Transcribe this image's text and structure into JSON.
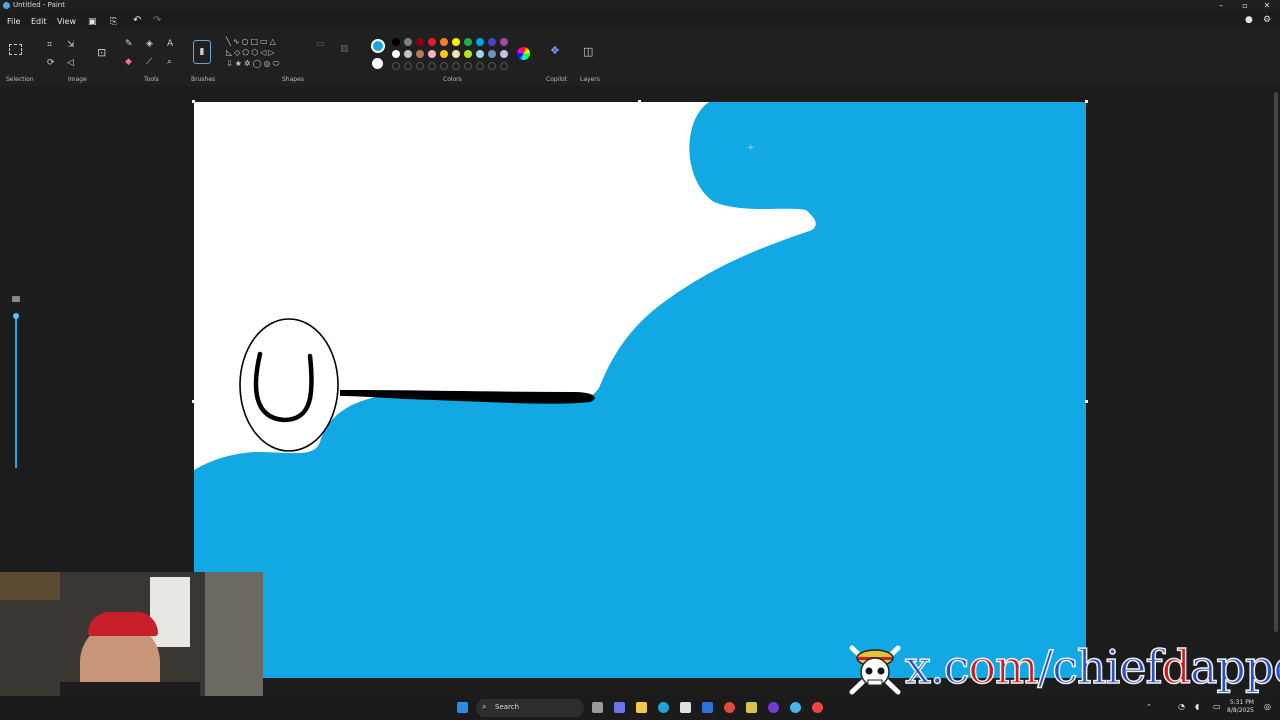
{
  "window": {
    "title": "Untitled - Paint",
    "controls": {
      "minimize": "–",
      "maximize": "▫",
      "close": "✕"
    }
  },
  "menu": {
    "file": "File",
    "edit": "Edit",
    "view": "View"
  },
  "ribbon": {
    "groups": {
      "selection": "Selection",
      "image": "Image",
      "tools": "Tools",
      "brushes": "Brushes",
      "shapes": "Shapes",
      "colors": "Colors",
      "copilot": "Copilot",
      "layers": "Layers"
    },
    "active_color": "#12a8e4",
    "secondary_color": "#ffffff",
    "palette_row1": [
      "#000000",
      "#7f7f7f",
      "#880015",
      "#ed1c24",
      "#ff7f27",
      "#fff200",
      "#22b14c",
      "#00a2e8",
      "#3f48cc",
      "#a349a4"
    ],
    "palette_row2": [
      "#ffffff",
      "#c3c3c3",
      "#b97a57",
      "#ffaec9",
      "#ffc90e",
      "#efe4b0",
      "#b5e61d",
      "#99d9ea",
      "#7092be",
      "#c8bfe7"
    ]
  },
  "canvas": {
    "background": "#ffffff",
    "fill_color": "#12a8e4",
    "stroke_color": "#000000",
    "drawn_letter": "U"
  },
  "taskbar": {
    "search_label": "Search",
    "time": "5:31 PM",
    "date": "8/8/2025"
  },
  "watermark": {
    "part1": "x.c",
    "part2": "om",
    "part3": "/chi",
    "part4": "e",
    "part5": "f",
    "part6": "d",
    "part7": "apper"
  }
}
